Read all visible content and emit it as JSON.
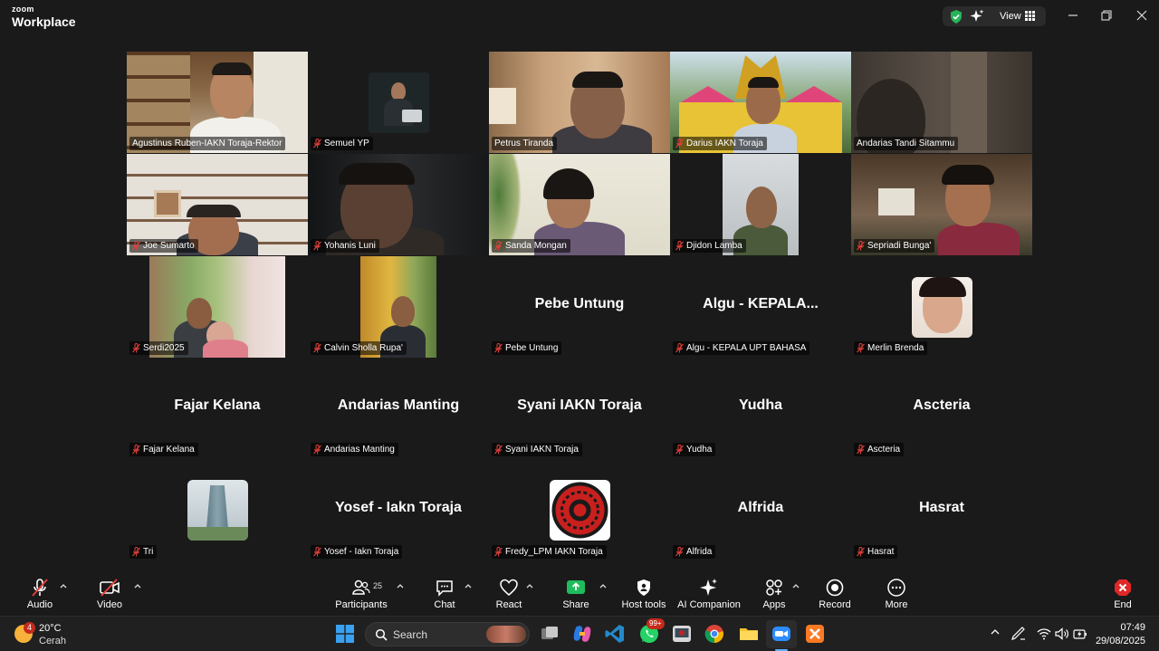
{
  "app": {
    "brand_top": "zoom",
    "brand_bottom": "Workplace",
    "view_label": "View"
  },
  "colors": {
    "active_speaker": "#3ccd72",
    "muted": "#e0403a",
    "end": "#e02828",
    "share": "#1fbb5c"
  },
  "participants": [
    {
      "name": "Agustinus Ruben-IAKN Toraja-Rektor",
      "video": true,
      "active": true
    },
    {
      "name": "Semuel YP",
      "video": true,
      "muted": true
    },
    {
      "name": "Petrus Tiranda",
      "video": true
    },
    {
      "name": "Darius IAKN Toraja",
      "video": true,
      "muted": true
    },
    {
      "name": "Andarias Tandi Sitammu",
      "video": true
    },
    {
      "name": "Joe Sumarto",
      "video": true,
      "muted": true
    },
    {
      "name": "Yohanis Luni",
      "video": true,
      "muted": true
    },
    {
      "name": "Sanda Mongan",
      "video": true,
      "muted": true
    },
    {
      "name": "Djidon Lamba",
      "video": true,
      "muted": true
    },
    {
      "name": "Sepriadi Bunga'",
      "video": true,
      "muted": true
    },
    {
      "name": "Serdi2025",
      "video": true,
      "muted": true
    },
    {
      "name": "Calvin Sholla Rupa'",
      "video": true,
      "muted": true
    },
    {
      "name": "Pebe Untung",
      "display": "Pebe Untung",
      "muted": true
    },
    {
      "name": "Algu - KEPALA UPT BAHASA",
      "display": "Algu - KEPALA...",
      "muted": true
    },
    {
      "name": "Merlin Brenda",
      "avatar": true,
      "muted": true
    },
    {
      "name": "Fajar Kelana",
      "display": "Fajar Kelana",
      "muted": true
    },
    {
      "name": "Andarias Manting",
      "display": "Andarias Manting",
      "muted": true
    },
    {
      "name": "Syani IAKN Toraja",
      "display": "Syani IAKN Toraja",
      "muted": true
    },
    {
      "name": "Yudha",
      "display": "Yudha",
      "muted": true
    },
    {
      "name": "Ascteria",
      "display": "Ascteria",
      "muted": true
    },
    {
      "name": "Tri",
      "avatar": true,
      "muted": true
    },
    {
      "name": "Yosef - Iakn Toraja",
      "display": "Yosef - Iakn Toraja",
      "muted": true
    },
    {
      "name": "Fredy_LPM IAKN Toraja",
      "avatar": true,
      "muted": true
    },
    {
      "name": "Alfrida",
      "display": "Alfrida",
      "muted": true
    },
    {
      "name": "Hasrat",
      "display": "Hasrat",
      "muted": true
    }
  ],
  "toolbar": {
    "audio": "Audio",
    "video": "Video",
    "participants": "Participants",
    "participants_count": "25",
    "chat": "Chat",
    "react": "React",
    "share": "Share",
    "host_tools": "Host tools",
    "ai_companion": "AI Companion",
    "apps": "Apps",
    "record": "Record",
    "more": "More",
    "end": "End"
  },
  "taskbar": {
    "weather_temp": "20°C",
    "weather_desc": "Cerah",
    "weather_badge": "4",
    "search_placeholder": "Search",
    "whatsapp_badge": "99+",
    "time": "07:49",
    "date": "29/08/2025"
  }
}
